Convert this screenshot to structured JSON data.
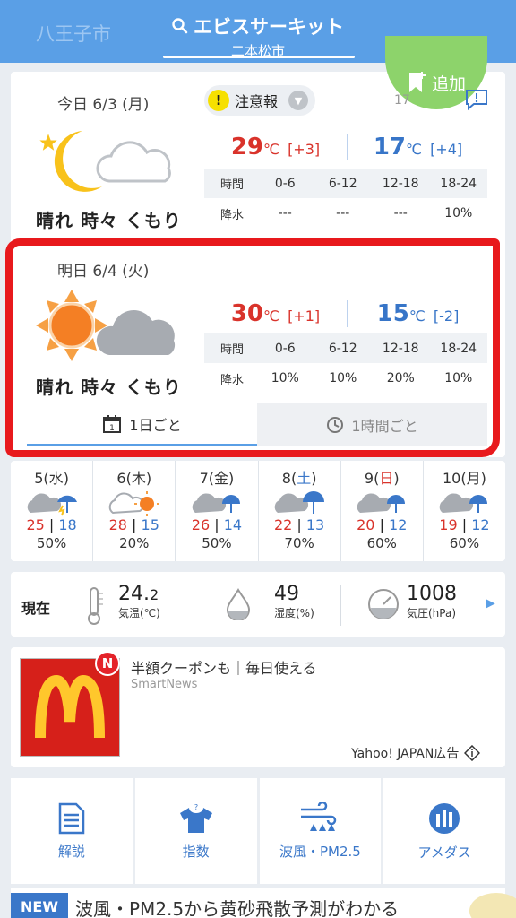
{
  "header": {
    "prev_city": "八王子市",
    "title": "エビスサーキット",
    "subtitle": "二本松市"
  },
  "add_button": {
    "label": "追加"
  },
  "today": {
    "label": "今日 6/3 (月)",
    "warning": "注意報",
    "partial": "17",
    "summary": "晴れ 時々 くもり",
    "high": "29",
    "high_diff": "[+3]",
    "low": "17",
    "low_diff": "[+4]",
    "unit": "℃",
    "rain_head": [
      "時間",
      "0-6",
      "6-12",
      "12-18",
      "18-24"
    ],
    "rain_row": [
      "降水",
      "---",
      "---",
      "---",
      "10%"
    ]
  },
  "tomorrow": {
    "label": "明日 6/4 (火)",
    "summary": "晴れ 時々 くもり",
    "high": "30",
    "high_diff": "[+1]",
    "low": "15",
    "low_diff": "[-2]",
    "unit": "℃",
    "rain_head": [
      "時間",
      "0-6",
      "6-12",
      "12-18",
      "18-24"
    ],
    "rain_row": [
      "降水",
      "10%",
      "10%",
      "20%",
      "10%"
    ]
  },
  "tabs": {
    "daily": "1日ごと",
    "hourly": "1時間ごと",
    "calendar_num": "1"
  },
  "week": [
    {
      "d": "5",
      "wd": "水",
      "hi": "25",
      "lo": "18",
      "pop": "50%"
    },
    {
      "d": "6",
      "wd": "木",
      "hi": "28",
      "lo": "15",
      "pop": "20%"
    },
    {
      "d": "7",
      "wd": "金",
      "hi": "26",
      "lo": "14",
      "pop": "50%"
    },
    {
      "d": "8",
      "wd": "土",
      "hi": "22",
      "lo": "13",
      "pop": "70%"
    },
    {
      "d": "9",
      "wd": "日",
      "hi": "20",
      "lo": "12",
      "pop": "60%"
    },
    {
      "d": "10",
      "wd": "月",
      "hi": "19",
      "lo": "12",
      "pop": "60%"
    }
  ],
  "current": {
    "label": "現在",
    "temp_int": "24.",
    "temp_dec": "2",
    "temp_cap": "気温(℃)",
    "humidity": "49",
    "humidity_cap": "湿度(%)",
    "pressure": "1008",
    "pressure_cap": "気圧(hPa)"
  },
  "ad": {
    "title": "半額クーポンも｜毎日使える",
    "source": "SmartNews",
    "badge": "N",
    "footer": "Yahoo! JAPAN広告"
  },
  "menu": [
    {
      "label": "解説",
      "icon": "document-icon"
    },
    {
      "label": "指数",
      "icon": "shirt-icon"
    },
    {
      "label": "波風・PM2.5",
      "icon": "wind-wave-icon"
    },
    {
      "label": "アメダス",
      "icon": "amedas-icon"
    }
  ],
  "banner": {
    "tag": "NEW",
    "text": "波風・PM2.5から黄砂飛散予測がわかる"
  },
  "colors": {
    "header": "#5a9fe6",
    "high": "#d9332b",
    "low": "#3775c8",
    "add": "#8dd36b",
    "highlight": "#e8191d"
  }
}
